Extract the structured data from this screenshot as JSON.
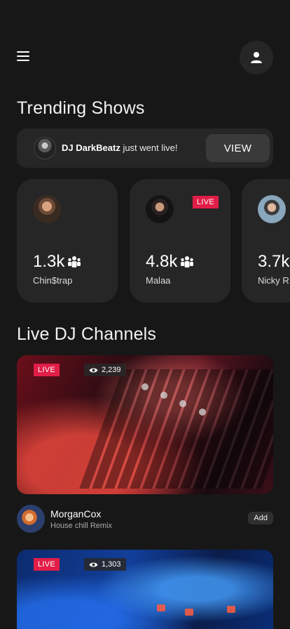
{
  "header": {
    "menu_icon": "hamburger-menu-icon",
    "profile_icon": "user-icon"
  },
  "trending": {
    "title": "Trending Shows",
    "banner": {
      "dj_name": "DJ DarkBeatz",
      "message": " just went live!",
      "button_label": "VIEW"
    },
    "cards": [
      {
        "count": "1.3k",
        "name": "Chin$trap",
        "live": false
      },
      {
        "count": "4.8k",
        "name": "Malaa",
        "live": true,
        "live_label": "LIVE"
      },
      {
        "count": "3.7k",
        "name": "Nicky R",
        "live": false
      }
    ],
    "audience_icon": "group-icon"
  },
  "channels": {
    "title": "Live DJ Channels",
    "items": [
      {
        "live_label": "LIVE",
        "viewers": "2,239",
        "dj_name": "MorganCox",
        "subtitle": "House chill Remix",
        "add_label": "Add"
      },
      {
        "live_label": "LIVE",
        "viewers": "1,303"
      }
    ],
    "viewers_icon": "eye-icon"
  },
  "colors": {
    "background": "#171717",
    "card": "#262626",
    "live": "#e11d48"
  }
}
